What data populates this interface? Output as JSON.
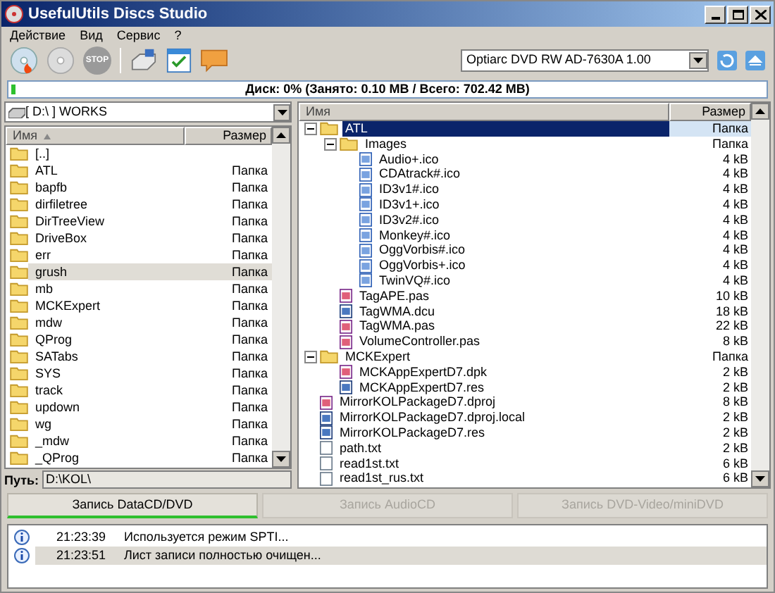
{
  "window": {
    "title": "UsefulUtils Discs Studio"
  },
  "menu": [
    "Действие",
    "Вид",
    "Сервис",
    "?"
  ],
  "toolbar": [
    {
      "kind": "burn"
    },
    {
      "kind": "disc"
    },
    {
      "kind": "stop",
      "label": "STOP"
    },
    {
      "kind": "drive"
    },
    {
      "kind": "calendar"
    },
    {
      "kind": "chat"
    }
  ],
  "drive_select": {
    "value": "Optiarc DVD RW AD-7630A 1.00"
  },
  "disk_bar": {
    "text": "Диск: 0% (Занято: 0.10 MB / Всего: 702.42 MB)",
    "level": 0.005
  },
  "left_panel": {
    "drive": "[ D:\\ ] WORKS",
    "columns": [
      "Имя",
      "Размер"
    ],
    "rows": [
      {
        "name": "[..]",
        "size": "",
        "selected": false
      },
      {
        "name": "ATL",
        "size": "Папка",
        "selected": false
      },
      {
        "name": "bapfb",
        "size": "Папка",
        "selected": false
      },
      {
        "name": "dirfiletree",
        "size": "Папка",
        "selected": false
      },
      {
        "name": "DirTreeView",
        "size": "Папка",
        "selected": false
      },
      {
        "name": "DriveBox",
        "size": "Папка",
        "selected": false
      },
      {
        "name": "err",
        "size": "Папка",
        "selected": false
      },
      {
        "name": "grush",
        "size": "Папка",
        "selected": true
      },
      {
        "name": "mb",
        "size": "Папка",
        "selected": false
      },
      {
        "name": "MCKExpert",
        "size": "Папка",
        "selected": false
      },
      {
        "name": "mdw",
        "size": "Папка",
        "selected": false
      },
      {
        "name": "QProg",
        "size": "Папка",
        "selected": false
      },
      {
        "name": "SATabs",
        "size": "Папка",
        "selected": false
      },
      {
        "name": "SYS",
        "size": "Папка",
        "selected": false
      },
      {
        "name": "track",
        "size": "Папка",
        "selected": false
      },
      {
        "name": "updown",
        "size": "Папка",
        "selected": false
      },
      {
        "name": "wg",
        "size": "Папка",
        "selected": false
      },
      {
        "name": "_mdw",
        "size": "Папка",
        "selected": false
      },
      {
        "name": "_QProg",
        "size": "Папка",
        "selected": false
      }
    ],
    "path_label": "Путь:",
    "path": "D:\\KOL\\"
  },
  "right_panel": {
    "columns": [
      "Имя",
      "Размер"
    ],
    "tree": [
      {
        "name": "ATL",
        "size": "Папка",
        "kind": "folder",
        "expanded": true,
        "selected": true,
        "children": [
          {
            "name": "Images",
            "size": "Папка",
            "kind": "folder",
            "expanded": true,
            "selected": false,
            "children": [
              {
                "name": "Audio+.ico",
                "size": "4 kB",
                "kind": "ico",
                "selected": false
              },
              {
                "name": "CDAtrack#.ico",
                "size": "4 kB",
                "kind": "ico",
                "selected": false
              },
              {
                "name": "ID3v1#.ico",
                "size": "4 kB",
                "kind": "ico",
                "selected": false
              },
              {
                "name": "ID3v1+.ico",
                "size": "4 kB",
                "kind": "ico",
                "selected": false
              },
              {
                "name": "ID3v2#.ico",
                "size": "4 kB",
                "kind": "ico",
                "selected": false
              },
              {
                "name": "Monkey#.ico",
                "size": "4 kB",
                "kind": "ico",
                "selected": false
              },
              {
                "name": "OggVorbis#.ico",
                "size": "4 kB",
                "kind": "ico",
                "selected": false
              },
              {
                "name": "OggVorbis+.ico",
                "size": "4 kB",
                "kind": "ico",
                "selected": false
              },
              {
                "name": "TwinVQ#.ico",
                "size": "4 kB",
                "kind": "ico",
                "selected": false
              }
            ]
          },
          {
            "name": "TagAPE.pas",
            "size": "10 kB",
            "kind": "pas",
            "selected": false
          },
          {
            "name": "TagWMA.dcu",
            "size": "18 kB",
            "kind": "res",
            "selected": false
          },
          {
            "name": "TagWMA.pas",
            "size": "22 kB",
            "kind": "pas",
            "selected": false
          },
          {
            "name": "VolumeController.pas",
            "size": "8 kB",
            "kind": "pas",
            "selected": false
          }
        ]
      },
      {
        "name": "MCKExpert",
        "size": "Папка",
        "kind": "folder",
        "expanded": true,
        "selected": false,
        "children": [
          {
            "name": "MCKAppExpertD7.dpk",
            "size": "2 kB",
            "kind": "pas",
            "selected": false
          },
          {
            "name": "MCKAppExpertD7.res",
            "size": "2 kB",
            "kind": "res",
            "selected": false
          }
        ]
      },
      {
        "name": "MirrorKOLPackageD7.dproj",
        "size": "8 kB",
        "kind": "pas",
        "selected": false
      },
      {
        "name": "MirrorKOLPackageD7.dproj.local",
        "size": "2 kB",
        "kind": "res",
        "selected": false
      },
      {
        "name": "MirrorKOLPackageD7.res",
        "size": "2 kB",
        "kind": "res",
        "selected": false
      },
      {
        "name": "path.txt",
        "size": "2 kB",
        "kind": "txt",
        "selected": false
      },
      {
        "name": "read1st.txt",
        "size": "6 kB",
        "kind": "txt",
        "selected": false
      },
      {
        "name": "read1st_rus.txt",
        "size": "6 kB",
        "kind": "txt",
        "selected": false
      }
    ]
  },
  "mode_buttons": [
    {
      "label": "Запись DataCD/DVD",
      "selected": true,
      "disabled": false
    },
    {
      "label": "Запись AudioCD",
      "selected": false,
      "disabled": true
    },
    {
      "label": "Запись DVD-Video/miniDVD",
      "selected": false,
      "disabled": true
    }
  ],
  "log": [
    {
      "time": "21:23:39",
      "message": "Используется режим SPTI...",
      "selected": false
    },
    {
      "time": "21:23:51",
      "message": "Лист записи полностью очищен...",
      "selected": true
    }
  ]
}
